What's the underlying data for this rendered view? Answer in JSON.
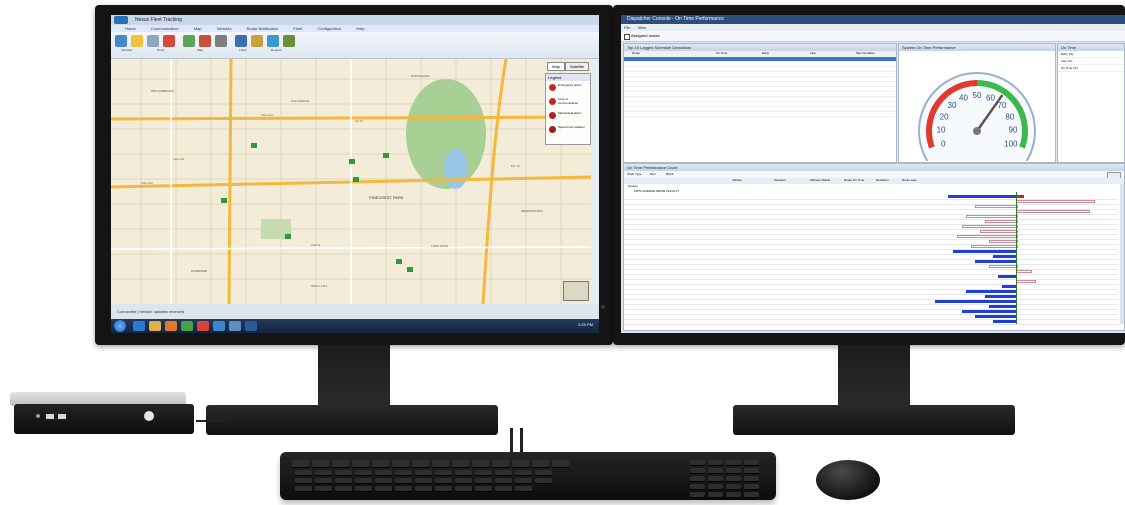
{
  "left_screen": {
    "window_title": "Nexus Fleet Tracking",
    "ribbon_tabs": [
      "Home",
      "Communication",
      "Map",
      "Vehicles",
      "Route Notification",
      "Fleet",
      "Configuration",
      "Help"
    ],
    "ribbon_groups": [
      "Vehicles",
      "Tools",
      "Map",
      "Track",
      "Reports"
    ],
    "map_mode_buttons": [
      "Map",
      "Satellite"
    ],
    "legend_label": "Legend",
    "legend_items": [
      "Emergency alarm",
      "Loss of communication",
      "Mechanical alarm",
      "Speed limit violation"
    ],
    "map_labels": [
      "PINECREST PARK",
      "WILLOWBROOK",
      "MEADOWLARK",
      "OAK GROVE",
      "RIVERSIDE",
      "NORTHGATE",
      "LAKE VISTA",
      "HOLLY HILL"
    ],
    "street_labels": [
      "Main Ave",
      "Park Ave",
      "1st St",
      "Oak St",
      "Lake Rd",
      "Elm St"
    ],
    "status_bar": "Connected | Vehicle updates received",
    "clock": "2:25 PM"
  },
  "right_screen": {
    "window_title": "Dispatcher Console - On Time Performance",
    "menu_items": [
      "File",
      "View"
    ],
    "toolbar_label": "Assigned routes",
    "routes_panel_title": "Top 10 Lagged Schedule Deviations",
    "routes_columns": [
      "Route",
      "On Time",
      "Early",
      "Late",
      "Max Deviation"
    ],
    "gauge_panel_title": "System On Time Performance",
    "filter_panel_title": "On Time",
    "filter_items": [
      "Early (%)",
      "Late (%)",
      "On Time (%)"
    ],
    "grid_panel_title": "On Time Performance Chart",
    "grid_toolbar": [
      "Chart Type",
      "Run",
      "Block"
    ],
    "grid_columns": [
      "Vehicle",
      "Operator",
      "Offroute Status",
      "Route On Time",
      "Deviation",
      "Route Late"
    ],
    "grid_root": "System",
    "grid_facility": "FIFTH AVENUE DRIVE FACILITY",
    "gauge_ticks": [
      0,
      10,
      20,
      30,
      40,
      50,
      60,
      70,
      80,
      90,
      100
    ],
    "gauge_value": 66
  },
  "colors": {
    "bar_blue": "#1f3fd6",
    "bar_red": "#d81c1c",
    "bar_outline": "#c58a94",
    "panel_blue": "#2d4f7c",
    "taskbar": "#1a3050",
    "gauge_green": "#3cb94a",
    "gauge_red": "#e03a2e"
  },
  "grid_bars": [
    {
      "type": "blue",
      "dir": "left",
      "len": 0.75
    },
    {
      "type": "outline",
      "dir": "right",
      "len": 0.85
    },
    {
      "type": "outline",
      "dir": "left",
      "len": 0.45
    },
    {
      "type": "outline",
      "dir": "right",
      "len": 0.8
    },
    {
      "type": "outline",
      "dir": "left",
      "len": 0.55
    },
    {
      "type": "outline",
      "dir": "left",
      "len": 0.35
    },
    {
      "type": "outline",
      "dir": "left",
      "len": 0.6
    },
    {
      "type": "outline",
      "dir": "left",
      "len": 0.4
    },
    {
      "type": "outline",
      "dir": "left",
      "len": 0.65
    },
    {
      "type": "outline",
      "dir": "left",
      "len": 0.3
    },
    {
      "type": "outline",
      "dir": "left",
      "len": 0.5
    },
    {
      "type": "blue",
      "dir": "left",
      "len": 0.7
    },
    {
      "type": "blue",
      "dir": "left",
      "len": 0.25
    },
    {
      "type": "blue",
      "dir": "left",
      "len": 0.45
    },
    {
      "type": "outline",
      "dir": "left",
      "len": 0.3
    },
    {
      "type": "outline",
      "dir": "right",
      "len": 0.15
    },
    {
      "type": "blue",
      "dir": "left",
      "len": 0.2
    },
    {
      "type": "outline",
      "dir": "right",
      "len": 0.2
    },
    {
      "type": "blue",
      "dir": "left",
      "len": 0.15
    },
    {
      "type": "blue",
      "dir": "left",
      "len": 0.55
    },
    {
      "type": "blue",
      "dir": "left",
      "len": 0.35
    },
    {
      "type": "blue",
      "dir": "left",
      "len": 0.9
    },
    {
      "type": "blue",
      "dir": "left",
      "len": 0.3
    },
    {
      "type": "blue",
      "dir": "left",
      "len": 0.6
    },
    {
      "type": "blue",
      "dir": "left",
      "len": 0.45
    },
    {
      "type": "blue",
      "dir": "left",
      "len": 0.25
    }
  ],
  "peripherals": {
    "devices": [
      "thin-client",
      "keyboard",
      "mouse"
    ]
  }
}
